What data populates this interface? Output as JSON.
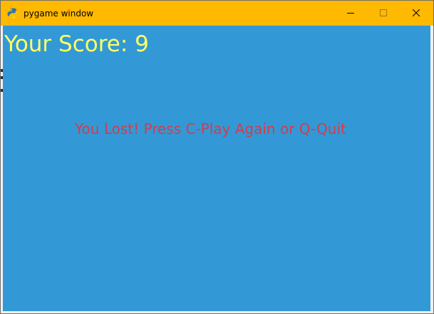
{
  "window": {
    "title": "pygame window",
    "app_icon": "pygame-snake-icon",
    "controls": {
      "minimize_icon": "minimize-icon",
      "maximize_icon": "maximize-icon",
      "close_icon": "close-icon"
    }
  },
  "game": {
    "score_text": "Your Score: 9",
    "message_text": "You Lost! Press C-Play Again or Q-Quit"
  },
  "colors": {
    "titlebar": "#ffb900",
    "background": "#3299d6",
    "score_text": "#ffff66",
    "message_text": "#d23c4e"
  }
}
